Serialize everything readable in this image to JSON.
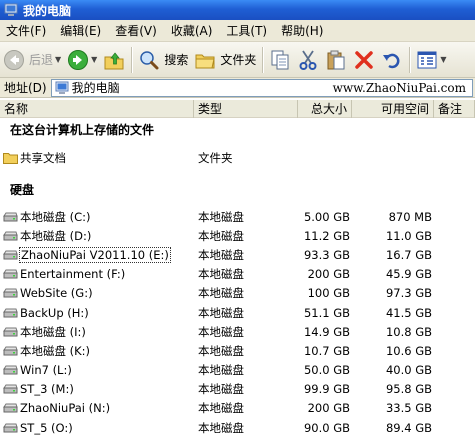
{
  "window": {
    "title": "我的电脑"
  },
  "menu": [
    "文件(F)",
    "编辑(E)",
    "查看(V)",
    "收藏(A)",
    "工具(T)",
    "帮助(H)"
  ],
  "toolbar": {
    "back": "后退",
    "search": "搜索",
    "folders": "文件夹"
  },
  "address": {
    "label": "地址(D)",
    "value": "我的电脑",
    "watermark": "www.ZhaoNiuPai.com"
  },
  "columns": {
    "name": "名称",
    "type": "类型",
    "total": "总大小",
    "free": "可用空间",
    "note": "备注"
  },
  "groups": {
    "stored": "在这台计算机上存储的文件",
    "hdd": "硬盘"
  },
  "shared": {
    "name": "共享文档",
    "type": "文件夹"
  },
  "drives": [
    {
      "name": "本地磁盘 (C:)",
      "type": "本地磁盘",
      "total": "5.00 GB",
      "free": "870 MB"
    },
    {
      "name": "本地磁盘 (D:)",
      "type": "本地磁盘",
      "total": "11.2 GB",
      "free": "11.0 GB"
    },
    {
      "name": "ZhaoNiuPai V2011.10 (E:)",
      "type": "本地磁盘",
      "total": "93.3 GB",
      "free": "16.7 GB"
    },
    {
      "name": "Entertainment (F:)",
      "type": "本地磁盘",
      "total": "200 GB",
      "free": "45.9 GB"
    },
    {
      "name": "WebSite (G:)",
      "type": "本地磁盘",
      "total": "100 GB",
      "free": "97.3 GB"
    },
    {
      "name": "BackUp (H:)",
      "type": "本地磁盘",
      "total": "51.1 GB",
      "free": "41.5 GB"
    },
    {
      "name": "本地磁盘 (I:)",
      "type": "本地磁盘",
      "total": "14.9 GB",
      "free": "10.8 GB"
    },
    {
      "name": "本地磁盘 (K:)",
      "type": "本地磁盘",
      "total": "10.7 GB",
      "free": "10.6 GB"
    },
    {
      "name": "Win7 (L:)",
      "type": "本地磁盘",
      "total": "50.0 GB",
      "free": "40.0 GB"
    },
    {
      "name": "ST_3 (M:)",
      "type": "本地磁盘",
      "total": "99.9 GB",
      "free": "95.8 GB"
    },
    {
      "name": "ZhaoNiuPai (N:)",
      "type": "本地磁盘",
      "total": "200 GB",
      "free": "33.5 GB"
    },
    {
      "name": "ST_5 (O:)",
      "type": "本地磁盘",
      "total": "90.0 GB",
      "free": "89.4 GB"
    }
  ]
}
